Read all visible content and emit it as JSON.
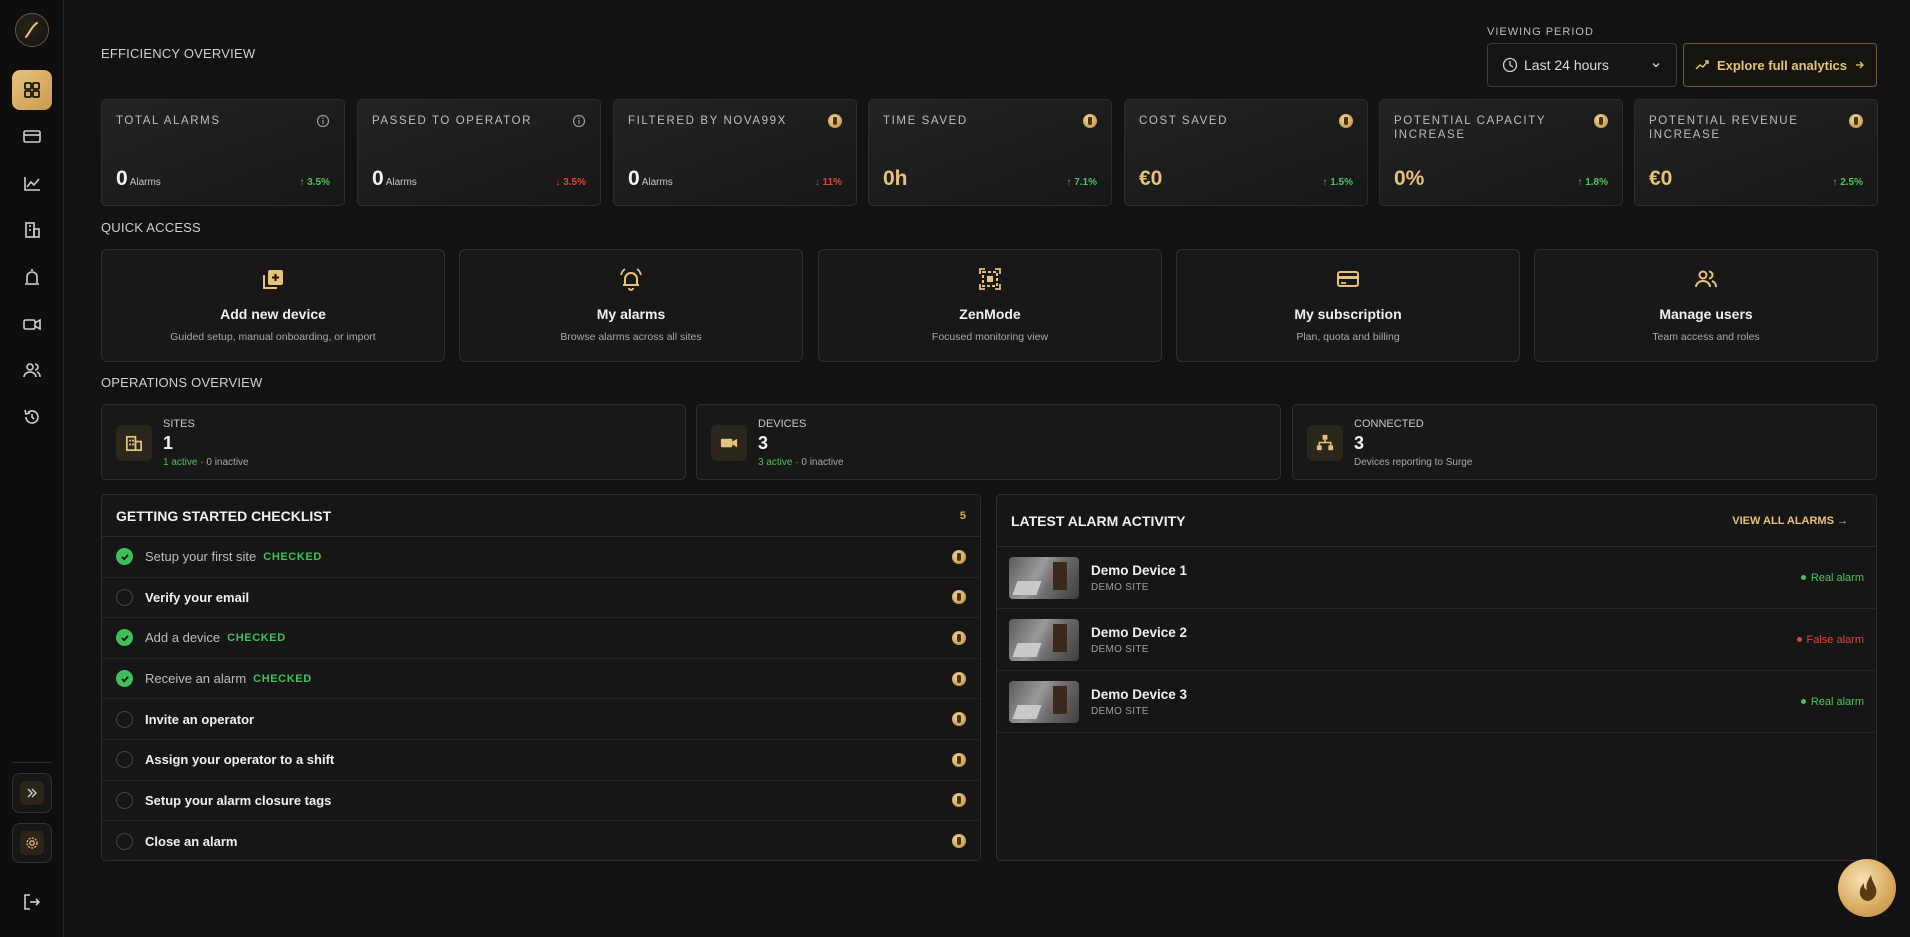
{
  "sidebar": {
    "nav": [
      "dashboard",
      "billing",
      "analytics",
      "sites",
      "alarms",
      "cameras",
      "users",
      "history"
    ]
  },
  "header": {
    "efficiency_title": "EFFICIENCY OVERVIEW",
    "viewing_period_label": "VIEWING PERIOD",
    "period_value": "Last 24 hours",
    "analytics_button": "Explore full analytics"
  },
  "kpis": [
    {
      "label": "TOTAL ALARMS",
      "value": "0",
      "unit": "Alarms",
      "delta": "↑ 3.5%",
      "trend": "up",
      "icon": "info-icon"
    },
    {
      "label": "PASSED TO OPERATOR",
      "value": "0",
      "unit": "Alarms",
      "delta": "↓ 3.5%",
      "trend": "down",
      "icon": "info-icon"
    },
    {
      "label": "FILTERED BY NOVA99X",
      "value": "0",
      "unit": "Alarms",
      "delta": "↓ 11%",
      "trend": "down",
      "icon": "coin-icon"
    },
    {
      "label": "TIME SAVED",
      "value": "0h",
      "unit": "",
      "delta": "↑ 7.1%",
      "trend": "up",
      "icon": "coin-icon"
    },
    {
      "label": "COST SAVED",
      "value": "€0",
      "unit": "",
      "delta": "↑ 1.5%",
      "trend": "up",
      "icon": "coin-icon"
    },
    {
      "label": "POTENTIAL CAPACITY INCREASE",
      "value": "0%",
      "unit": "",
      "delta": "↑ 1.8%",
      "trend": "up",
      "icon": "coin-icon"
    },
    {
      "label": "POTENTIAL REVENUE INCREASE",
      "value": "€0",
      "unit": "",
      "delta": "↑ 2.5%",
      "trend": "up",
      "icon": "coin-icon"
    }
  ],
  "quick_access": {
    "title": "QUICK ACCESS",
    "items": [
      {
        "title": "Add new device",
        "sub": "Guided setup, manual onboarding, or import",
        "icon": "add-device-icon"
      },
      {
        "title": "My alarms",
        "sub": "Browse alarms across all sites",
        "icon": "bell-icon"
      },
      {
        "title": "ZenMode",
        "sub": "Focused monitoring view",
        "icon": "zen-icon"
      },
      {
        "title": "My subscription",
        "sub": "Plan, quota and billing",
        "icon": "card-icon"
      },
      {
        "title": "Manage users",
        "sub": "Team access and roles",
        "icon": "users-icon"
      }
    ]
  },
  "operations": {
    "title": "OPERATIONS OVERVIEW",
    "items": [
      {
        "label": "SITES",
        "value": "1",
        "active": "1 active",
        "rest": " · 0 inactive",
        "icon": "building-icon"
      },
      {
        "label": "DEVICES",
        "value": "3",
        "active": "3 active",
        "rest": " · 0 inactive",
        "icon": "camera-icon"
      },
      {
        "label": "CONNECTED",
        "value": "3",
        "active": "",
        "rest": "Devices reporting to Surge",
        "icon": "network-icon"
      }
    ]
  },
  "checklist": {
    "title": "GETTING STARTED CHECKLIST",
    "count": "5",
    "checked_tag": "CHECKED",
    "items": [
      {
        "text": "Setup your first site",
        "done": true
      },
      {
        "text": "Verify your email",
        "done": false
      },
      {
        "text": "Add a device",
        "done": true
      },
      {
        "text": "Receive an alarm",
        "done": true
      },
      {
        "text": "Invite an operator",
        "done": false
      },
      {
        "text": "Assign your operator to a shift",
        "done": false
      },
      {
        "text": "Setup your alarm closure tags",
        "done": false
      },
      {
        "text": "Close an alarm",
        "done": false
      }
    ]
  },
  "alarms": {
    "title": "LATEST ALARM ACTIVITY",
    "view_all": "VIEW ALL ALARMS",
    "items": [
      {
        "device": "Demo Device 1",
        "site": "DEMO SITE",
        "status": "Real alarm",
        "color": "#4cc35a"
      },
      {
        "device": "Demo Device 2",
        "site": "DEMO SITE",
        "status": "False alarm",
        "color": "#e0453a"
      },
      {
        "device": "Demo Device 3",
        "site": "DEMO SITE",
        "status": "Real alarm",
        "color": "#4cc35a"
      }
    ]
  },
  "colors": {
    "accent": "#e6c27a",
    "up": "#4cc35a",
    "down": "#e0453a",
    "background": "#121212"
  }
}
